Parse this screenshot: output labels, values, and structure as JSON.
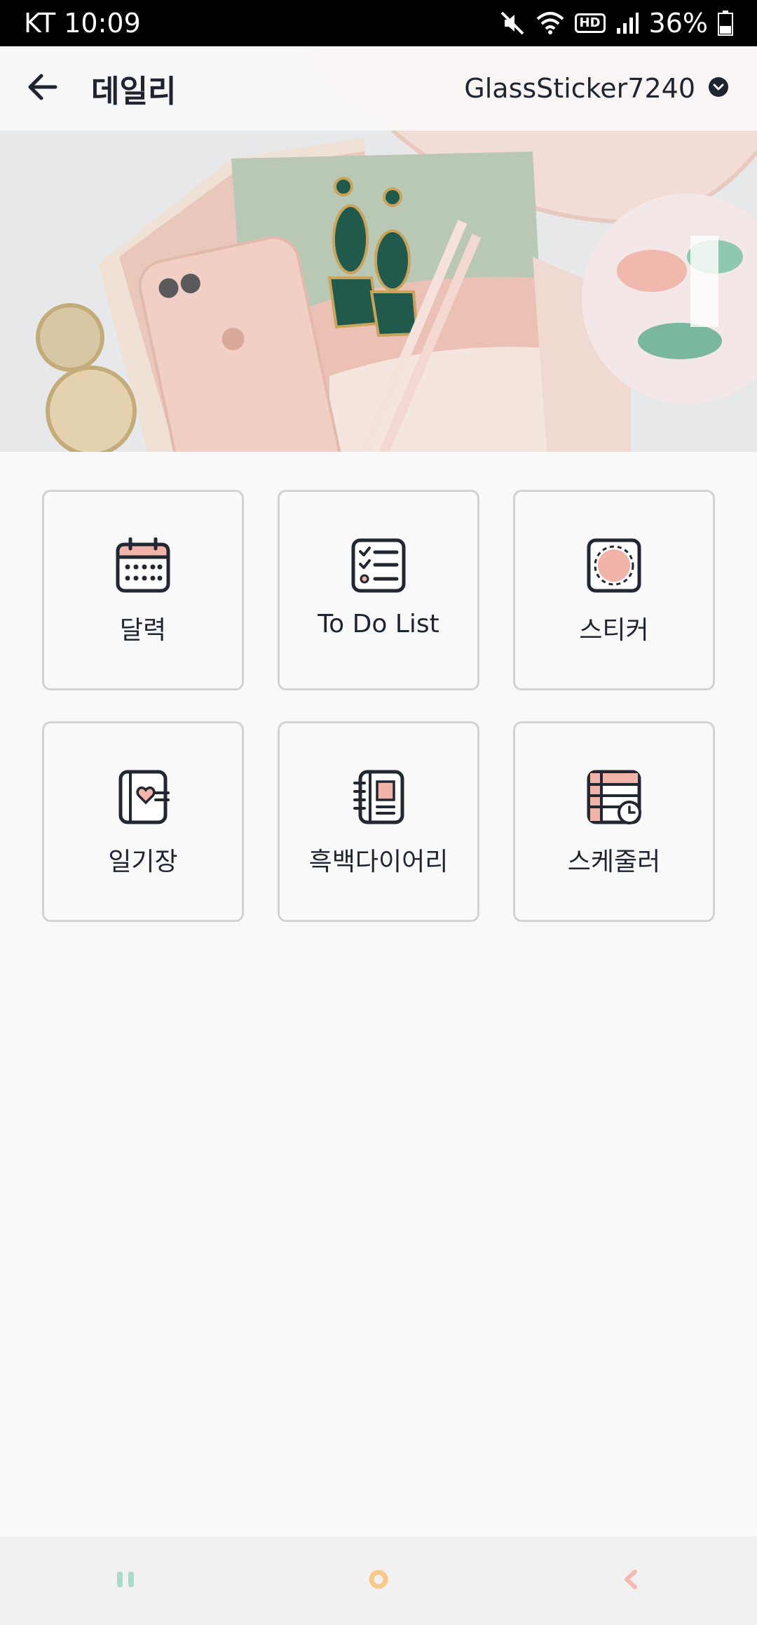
{
  "status_bar": {
    "carrier_time": "KT 10:09",
    "battery": "36%",
    "hd": "HD",
    "icons": [
      "mute-icon",
      "wifi-icon",
      "hd-icon",
      "signal-icon",
      "battery-icon"
    ]
  },
  "header": {
    "title": "데일리",
    "account": "GlassSticker7240",
    "back_icon": "arrow-left-icon",
    "dropdown_icon": "chevron-down-circle-icon"
  },
  "menu": [
    {
      "label": "달력",
      "icon": "calendar-icon"
    },
    {
      "label": "To Do List",
      "icon": "checklist-icon"
    },
    {
      "label": "스티커",
      "icon": "sticker-icon"
    },
    {
      "label": "일기장",
      "icon": "diary-icon"
    },
    {
      "label": "흑백다이어리",
      "icon": "notebook-icon"
    },
    {
      "label": "스케줄러",
      "icon": "scheduler-icon"
    }
  ],
  "nav": [
    "recent-apps-icon",
    "home-icon",
    "back-icon"
  ],
  "colors": {
    "accent_pink": "#f2b3a9",
    "icon_stroke": "#222831",
    "nav_teal": "#a8dcc8",
    "nav_orange": "#f7c98a",
    "nav_pink": "#f5b9b0"
  }
}
